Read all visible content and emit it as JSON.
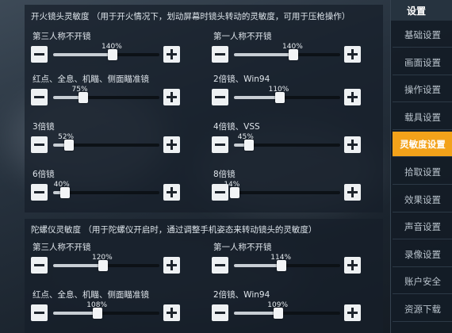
{
  "fire_panel": {
    "title": "开火镜头灵敏度 （用于开火情况下，划动屏幕时镜头转动的灵敏度，可用于压枪操作）",
    "settings": [
      {
        "label": "第三人称不开镜",
        "value": "140%",
        "level": 0.56
      },
      {
        "label": "第一人称不开镜",
        "value": "140%",
        "level": 0.56
      },
      {
        "label": "红点、全息、机瞄、侧面瞄准镜",
        "value": "75%",
        "level": 0.28
      },
      {
        "label": "2倍镜、Win94",
        "value": "110%",
        "level": 0.43
      },
      {
        "label": "3倍镜",
        "value": "52%",
        "level": 0.15
      },
      {
        "label": "4倍镜、VSS",
        "value": "45%",
        "level": 0.14
      },
      {
        "label": "6倍镜",
        "value": "40%",
        "level": 0.11
      },
      {
        "label": "8倍镜",
        "value": "14%",
        "level": 0.01
      }
    ]
  },
  "gyro_panel": {
    "title": "陀螺仪灵敏度 （用于陀螺仪开启时，通过调整手机姿态来转动镜头的灵敏度）",
    "settings": [
      {
        "label": "第三人称不开镜",
        "value": "120%",
        "level": 0.47
      },
      {
        "label": "第一人称不开镜",
        "value": "114%",
        "level": 0.45
      },
      {
        "label": "红点、全息、机瞄、侧面瞄准镜",
        "value": "108%",
        "level": 0.42
      },
      {
        "label": "2倍镜、Win94",
        "value": "109%",
        "level": 0.42
      }
    ]
  },
  "sidebar": {
    "title": "设置",
    "active_color": "#f3a21a",
    "items": [
      {
        "label": "基础设置"
      },
      {
        "label": "画面设置"
      },
      {
        "label": "操作设置"
      },
      {
        "label": "载具设置"
      },
      {
        "label": "灵敏度设置",
        "active": true
      },
      {
        "label": "拾取设置"
      },
      {
        "label": "效果设置"
      },
      {
        "label": "声音设置"
      },
      {
        "label": "录像设置"
      },
      {
        "label": "账户安全"
      },
      {
        "label": "资源下载"
      }
    ]
  },
  "icons": {
    "decrease": "minus-icon",
    "increase": "plus-icon"
  }
}
